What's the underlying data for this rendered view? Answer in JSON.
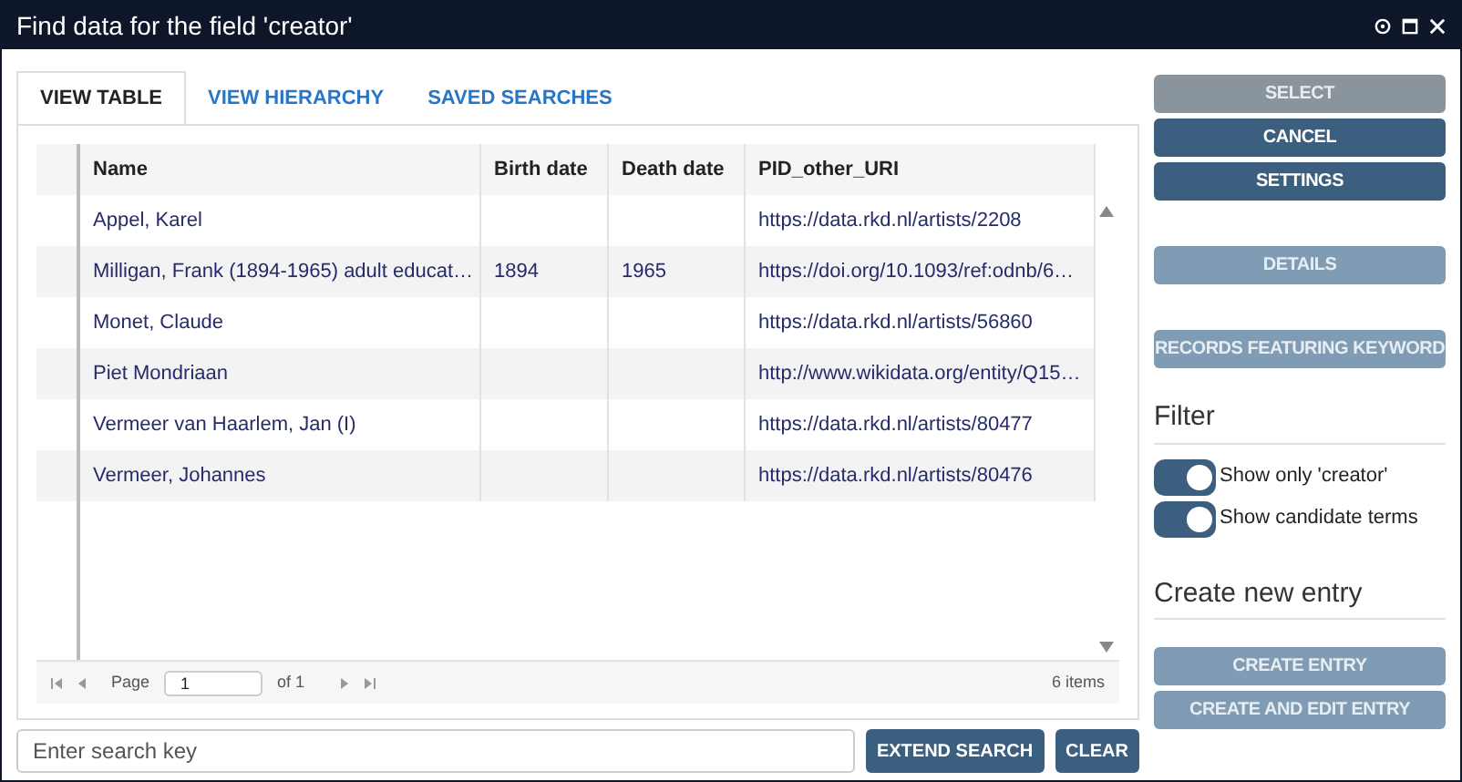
{
  "window": {
    "title": "Find data for the field 'creator'"
  },
  "tabs": [
    {
      "label": "VIEW TABLE",
      "selected": true
    },
    {
      "label": "VIEW HIERARCHY",
      "selected": false
    },
    {
      "label": "SAVED SEARCHES",
      "selected": false
    }
  ],
  "table": {
    "columns": [
      "Name",
      "Birth date",
      "Death date",
      "PID_other_URI"
    ],
    "rows": [
      [
        "Appel, Karel",
        "",
        "",
        "https://data.rkd.nl/artists/2208"
      ],
      [
        "Milligan, Frank (1894-1965) adult educat…",
        "1894",
        "1965",
        "https://doi.org/10.1093/ref:odnb/6…"
      ],
      [
        "Monet, Claude",
        "",
        "",
        "https://data.rkd.nl/artists/56860"
      ],
      [
        "Piet Mondriaan",
        "",
        "",
        "http://www.wikidata.org/entity/Q15…"
      ],
      [
        "Vermeer van Haarlem, Jan (I)",
        "",
        "",
        "https://data.rkd.nl/artists/80477"
      ],
      [
        "Vermeer, Johannes",
        "",
        "",
        "https://data.rkd.nl/artists/80476"
      ]
    ]
  },
  "pager": {
    "page_label": "Page",
    "page": "1",
    "of": "of 1",
    "count": "6 items"
  },
  "search": {
    "placeholder": "Enter search key",
    "buttons": [
      "EXTEND SEARCH",
      "CLEAR"
    ]
  },
  "actions": [
    {
      "label": "SELECT",
      "kind": "gray"
    },
    {
      "label": "CANCEL",
      "kind": "active"
    },
    {
      "label": "SETTINGS",
      "kind": "active"
    }
  ],
  "record_actions": [
    {
      "label": "DETAILS",
      "kind": "disabled"
    },
    {
      "label": "RECORDS FEATURING KEYWORD",
      "kind": "disabled"
    }
  ],
  "filter": {
    "title": "Filter",
    "toggles": [
      {
        "label": "Show only 'creator'",
        "on": true
      },
      {
        "label": "Show candidate terms",
        "on": true
      }
    ]
  },
  "create": {
    "title": "Create new entry",
    "buttons": [
      {
        "label": "CREATE ENTRY",
        "kind": "disabled"
      },
      {
        "label": "CREATE AND EDIT ENTRY",
        "kind": "disabled"
      }
    ]
  }
}
